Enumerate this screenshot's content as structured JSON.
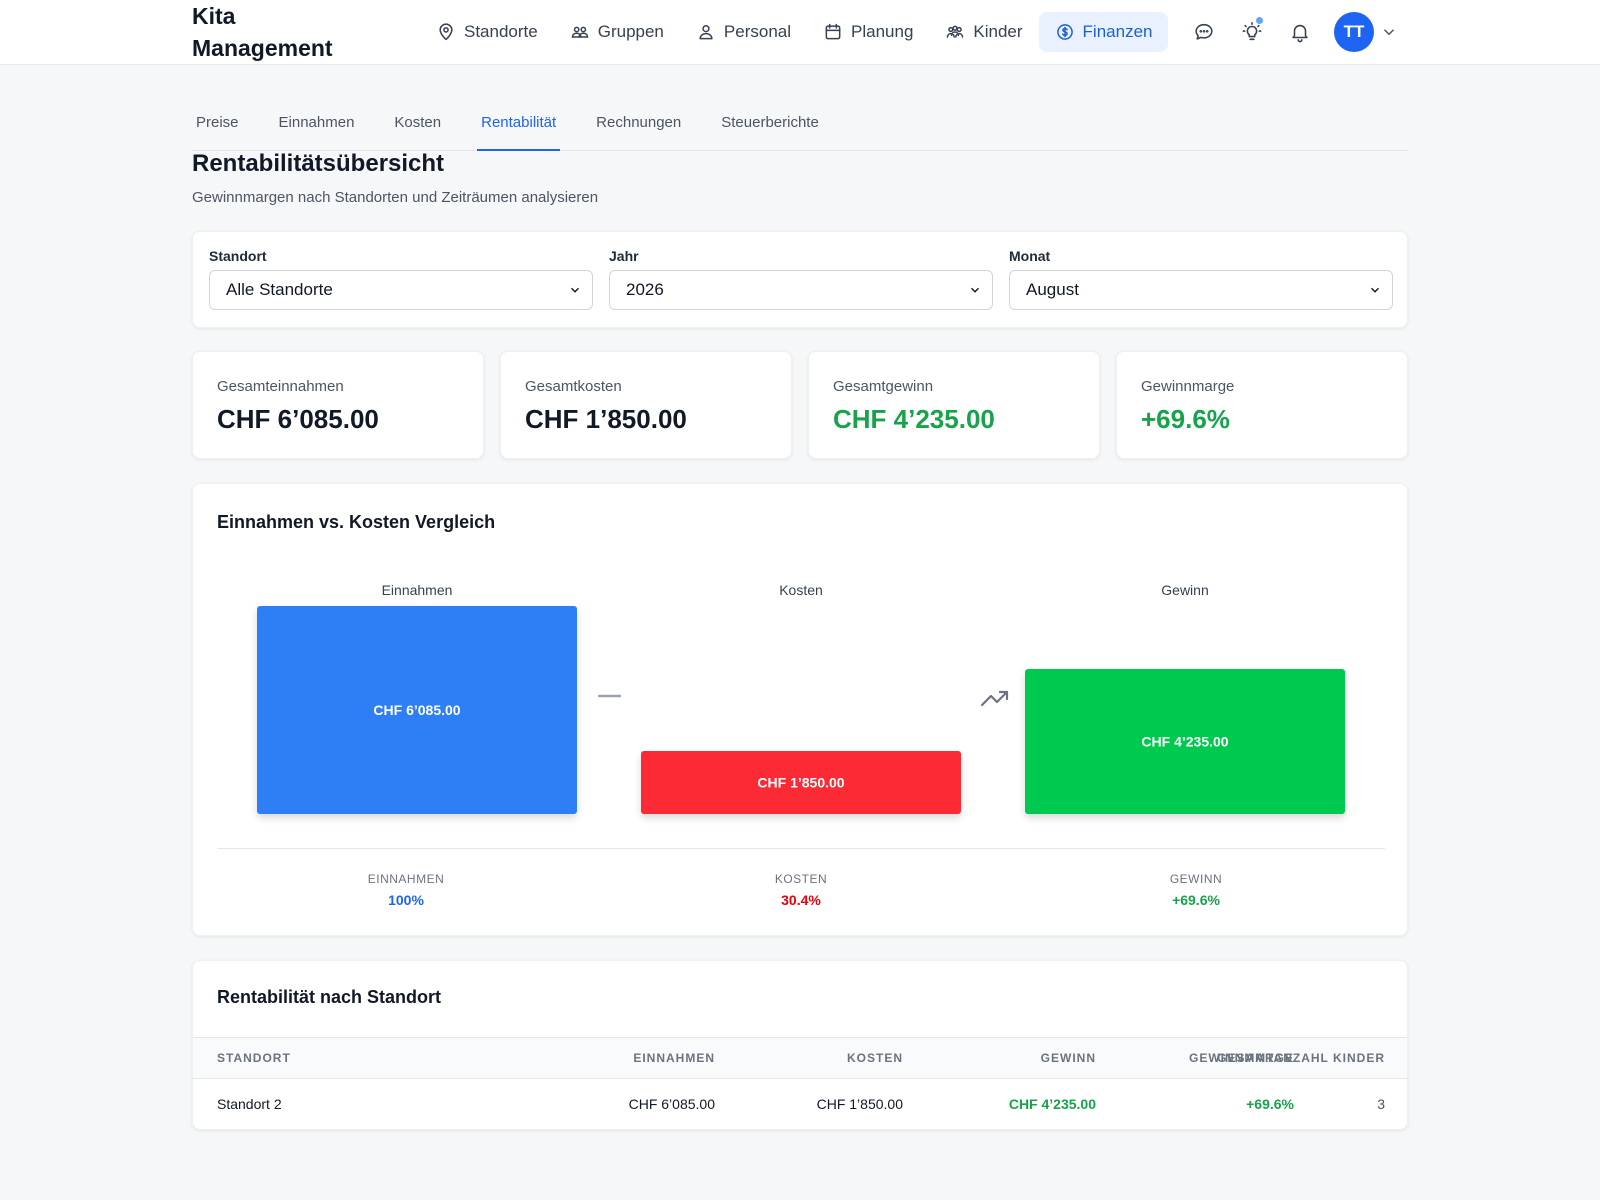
{
  "header": {
    "brand_line1": "Kita",
    "brand_line2": "Management",
    "nav": [
      {
        "label": "Standorte",
        "icon": "map-pin-icon"
      },
      {
        "label": "Gruppen",
        "icon": "users-icon"
      },
      {
        "label": "Personal",
        "icon": "user-icon"
      },
      {
        "label": "Planung",
        "icon": "calendar-icon"
      },
      {
        "label": "Kinder",
        "icon": "children-icon"
      },
      {
        "label": "Finanzen",
        "icon": "dollar-circle-icon",
        "active": true
      }
    ],
    "avatar_initials": "TT"
  },
  "subtabs": [
    {
      "label": "Preise"
    },
    {
      "label": "Einnahmen"
    },
    {
      "label": "Kosten"
    },
    {
      "label": "Rentabilität",
      "active": true
    },
    {
      "label": "Rechnungen"
    },
    {
      "label": "Steuerberichte"
    }
  ],
  "page": {
    "title": "Rentabilitätsübersicht",
    "subtitle": "Gewinnmargen nach Standorten und Zeiträumen analysieren"
  },
  "filters": {
    "standort": {
      "label": "Standort",
      "value": "Alle Standorte"
    },
    "jahr": {
      "label": "Jahr",
      "value": "2026"
    },
    "monat": {
      "label": "Monat",
      "value": "August"
    }
  },
  "stats": {
    "revenue": {
      "label": "Gesamteinnahmen",
      "value": "CHF 6’085.00"
    },
    "costs": {
      "label": "Gesamtkosten",
      "value": "CHF 1’850.00"
    },
    "profit": {
      "label": "Gesamtgewinn",
      "value": "CHF 4’235.00"
    },
    "margin": {
      "label": "Gewinnmarge",
      "value": "+69.6%"
    }
  },
  "chart_data": {
    "type": "bar",
    "title": "Einnahmen vs. Kosten Vergleich",
    "categories": [
      "Einnahmen",
      "Kosten",
      "Gewinn"
    ],
    "values": [
      6085,
      1850,
      4235
    ],
    "value_labels": [
      "CHF 6’085.00",
      "CHF 1’850.00",
      "CHF 4’235.00"
    ],
    "colors": [
      "#2f7ef5",
      "#fb2c36",
      "#00c950"
    ],
    "ylim": [
      0,
      6085
    ],
    "grid": false,
    "summary": [
      {
        "label": "EINNAHMEN",
        "value": "100%",
        "color": "#1d64f2"
      },
      {
        "label": "KOSTEN",
        "value": "30.4%",
        "color": "#e7000b"
      },
      {
        "label": "GEWINN",
        "value": "+69.6%",
        "color": "#16a34a"
      }
    ]
  },
  "table": {
    "title": "Rentabilität nach Standort",
    "columns": [
      "STANDORT",
      "EINNAHMEN",
      "KOSTEN",
      "GEWINN",
      "GEWINNMARGE",
      "GESAMTANZAHL KINDER"
    ],
    "rows": [
      [
        "Standort 2",
        "CHF 6’085.00",
        "CHF 1’850.00",
        "CHF 4’235.00",
        "+69.6%",
        "3"
      ]
    ]
  }
}
